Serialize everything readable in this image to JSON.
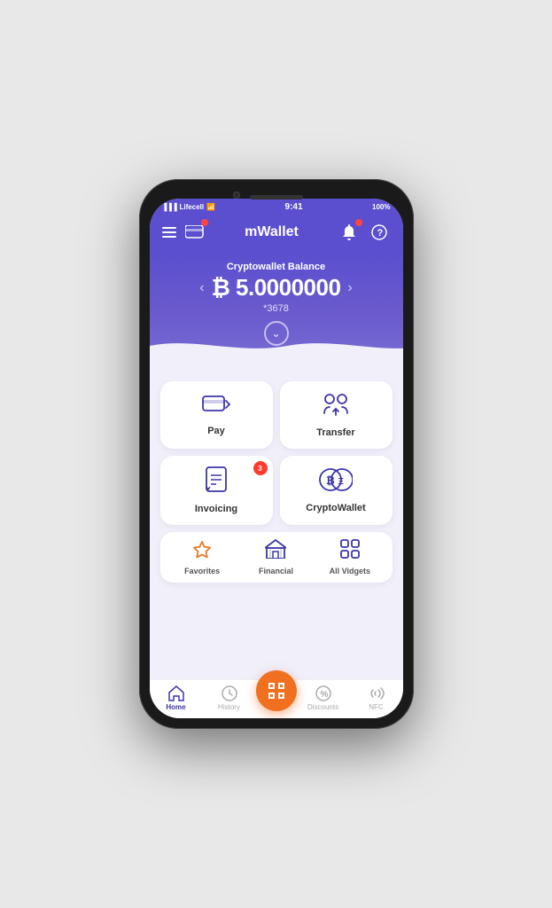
{
  "phone": {
    "status_bar": {
      "carrier": "Lifecell",
      "wifi_icon": "wifi",
      "time": "9:41",
      "battery": "100%"
    },
    "header": {
      "title": "mWallet",
      "menu_label": "menu",
      "card_label": "card",
      "notification_label": "notifications",
      "help_label": "help"
    },
    "hero": {
      "balance_label": "Cryptowallet Balance",
      "currency_symbol": "₿",
      "balance": "5.0000000",
      "account": "*3678",
      "prev_label": "previous",
      "next_label": "next",
      "expand_label": "expand"
    },
    "grid": {
      "row1": [
        {
          "id": "pay",
          "label": "Pay",
          "icon": "pay"
        },
        {
          "id": "transfer",
          "label": "Transfer",
          "icon": "transfer"
        }
      ],
      "row2": [
        {
          "id": "invoicing",
          "label": "Invoicing",
          "icon": "invoice",
          "badge": "3"
        },
        {
          "id": "cryptowallet",
          "label": "CryptoWallet",
          "icon": "crypto"
        }
      ],
      "row3": [
        {
          "id": "favorites",
          "label": "Favorites",
          "icon": "star"
        },
        {
          "id": "financial",
          "label": "Financial",
          "icon": "bank"
        },
        {
          "id": "allwidgets",
          "label": "All Vidgets",
          "icon": "grid"
        }
      ]
    },
    "tabs": [
      {
        "id": "home",
        "label": "Home",
        "icon": "home",
        "active": true
      },
      {
        "id": "history",
        "label": "History",
        "icon": "clock",
        "active": false
      },
      {
        "id": "scan",
        "label": "Scan",
        "icon": "scan",
        "active": false,
        "center": true
      },
      {
        "id": "discounts",
        "label": "Discounts",
        "icon": "percent",
        "active": false
      },
      {
        "id": "nfc",
        "label": "NFC",
        "icon": "nfc",
        "active": false
      }
    ]
  }
}
